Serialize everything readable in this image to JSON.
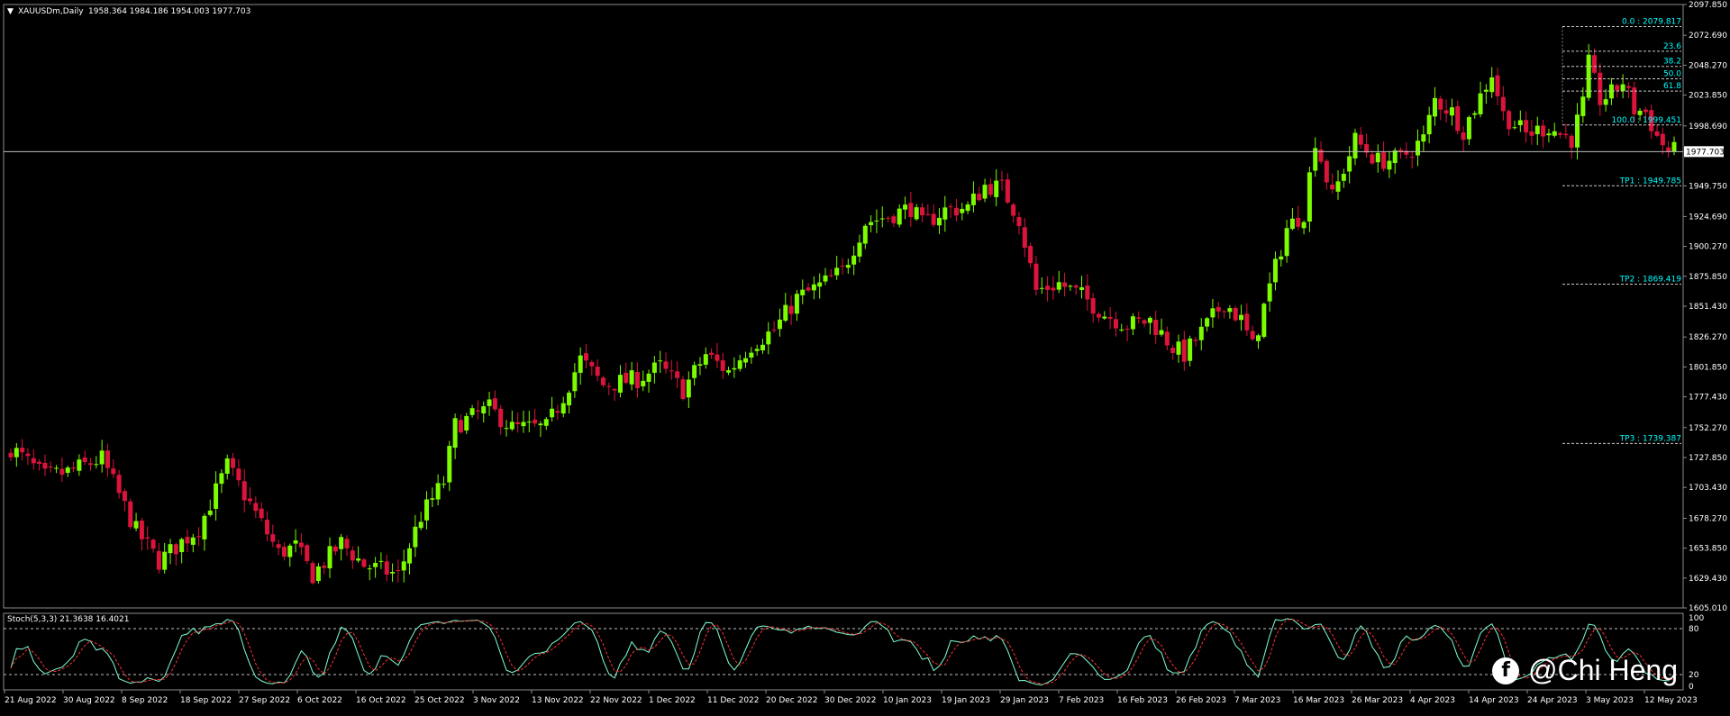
{
  "header": {
    "symbol": "XAUUSDm,Daily",
    "ohlc": "1958.364 1984.186 1954.003 1977.703"
  },
  "indicator": {
    "label": "Stoch(5,3,3) 21.3638 16.4021",
    "levels": [
      "100",
      "80",
      "20",
      "0"
    ]
  },
  "price_axis": {
    "ticks": [
      "2097.850",
      "2072.690",
      "2048.270",
      "2023.850",
      "1998.690",
      "1977.703",
      "1949.750",
      "1924.690",
      "1900.270",
      "1875.850",
      "1851.430",
      "1826.270",
      "1801.850",
      "1777.430",
      "1752.270",
      "1727.850",
      "1703.430",
      "1678.270",
      "1653.850",
      "1629.430",
      "1605.010"
    ],
    "current_price": "1977.703"
  },
  "fib_levels": [
    {
      "label": "0.0 : 2079.817",
      "value": 2079.817
    },
    {
      "label": "23.6",
      "value": 2059.7
    },
    {
      "label": "38.2",
      "value": 2047.3
    },
    {
      "label": "50.0",
      "value": 2037.2
    },
    {
      "label": "61.8",
      "value": 2027.1
    },
    {
      "label": "100.0 : 1999.451",
      "value": 1999.451
    }
  ],
  "targets": [
    {
      "label": "TP1 : 1949.785",
      "value": 1949.785
    },
    {
      "label": "TP2 : 1869.419",
      "value": 1869.419
    },
    {
      "label": "TP3 : 1739.387",
      "value": 1739.387
    }
  ],
  "watermark": "@Chi Heng",
  "chart_data": {
    "type": "candlestick",
    "symbol": "XAUUSDm",
    "timeframe": "Daily",
    "ylim": [
      1605.01,
      2097.85
    ],
    "x_tick_labels": [
      "21 Aug 2022",
      "30 Aug 2022",
      "8 Sep 2022",
      "18 Sep 2022",
      "27 Sep 2022",
      "6 Oct 2022",
      "16 Oct 2022",
      "25 Oct 2022",
      "3 Nov 2022",
      "13 Nov 2022",
      "22 Nov 2022",
      "1 Dec 2022",
      "11 Dec 2022",
      "20 Dec 2022",
      "30 Dec 2022",
      "10 Jan 2023",
      "19 Jan 2023",
      "29 Jan 2023",
      "7 Feb 2023",
      "16 Feb 2023",
      "26 Feb 2023",
      "7 Mar 2023",
      "16 Mar 2023",
      "26 Mar 2023",
      "4 Apr 2023",
      "14 Apr 2023",
      "24 Apr 2023",
      "3 May 2023",
      "12 May 2023"
    ],
    "close_path": [
      {
        "i": 0,
        "c": 1736
      },
      {
        "i": 6,
        "c": 1712
      },
      {
        "i": 10,
        "c": 1716
      },
      {
        "i": 16,
        "c": 1727
      },
      {
        "i": 22,
        "c": 1668
      },
      {
        "i": 26,
        "c": 1643
      },
      {
        "i": 30,
        "c": 1659
      },
      {
        "i": 33,
        "c": 1670
      },
      {
        "i": 38,
        "c": 1721
      },
      {
        "i": 42,
        "c": 1690
      },
      {
        "i": 47,
        "c": 1650
      },
      {
        "i": 50,
        "c": 1655
      },
      {
        "i": 53,
        "c": 1632
      },
      {
        "i": 58,
        "c": 1658
      },
      {
        "i": 62,
        "c": 1640
      },
      {
        "i": 68,
        "c": 1632
      },
      {
        "i": 72,
        "c": 1680
      },
      {
        "i": 76,
        "c": 1708
      },
      {
        "i": 78,
        "c": 1754
      },
      {
        "i": 84,
        "c": 1768
      },
      {
        "i": 88,
        "c": 1752
      },
      {
        "i": 94,
        "c": 1752
      },
      {
        "i": 97,
        "c": 1778
      },
      {
        "i": 100,
        "c": 1808
      },
      {
        "i": 104,
        "c": 1787
      },
      {
        "i": 110,
        "c": 1792
      },
      {
        "i": 114,
        "c": 1802
      },
      {
        "i": 118,
        "c": 1783
      },
      {
        "i": 122,
        "c": 1812
      },
      {
        "i": 126,
        "c": 1798
      },
      {
        "i": 130,
        "c": 1820
      },
      {
        "i": 134,
        "c": 1832
      },
      {
        "i": 138,
        "c": 1858
      },
      {
        "i": 142,
        "c": 1868
      },
      {
        "i": 146,
        "c": 1880
      },
      {
        "i": 150,
        "c": 1920
      },
      {
        "i": 154,
        "c": 1925
      },
      {
        "i": 158,
        "c": 1932
      },
      {
        "i": 160,
        "c": 1918
      },
      {
        "i": 164,
        "c": 1930
      },
      {
        "i": 168,
        "c": 1932
      },
      {
        "i": 171,
        "c": 1950
      },
      {
        "i": 174,
        "c": 1948
      },
      {
        "i": 177,
        "c": 1923
      },
      {
        "i": 180,
        "c": 1864
      },
      {
        "i": 184,
        "c": 1870
      },
      {
        "i": 188,
        "c": 1860
      },
      {
        "i": 192,
        "c": 1845
      },
      {
        "i": 196,
        "c": 1836
      },
      {
        "i": 200,
        "c": 1840
      },
      {
        "i": 204,
        "c": 1818
      },
      {
        "i": 206,
        "c": 1812
      },
      {
        "i": 210,
        "c": 1836
      },
      {
        "i": 213,
        "c": 1855
      },
      {
        "i": 216,
        "c": 1840
      },
      {
        "i": 218,
        "c": 1818
      },
      {
        "i": 221,
        "c": 1867
      },
      {
        "i": 224,
        "c": 1915
      },
      {
        "i": 227,
        "c": 1928
      },
      {
        "i": 229,
        "c": 1988
      },
      {
        "i": 232,
        "c": 1940
      },
      {
        "i": 236,
        "c": 1987
      },
      {
        "i": 240,
        "c": 1970
      },
      {
        "i": 244,
        "c": 1972
      },
      {
        "i": 248,
        "c": 1988
      },
      {
        "i": 250,
        "c": 2020
      },
      {
        "i": 253,
        "c": 2010
      },
      {
        "i": 255,
        "c": 1995
      },
      {
        "i": 258,
        "c": 2023
      },
      {
        "i": 260,
        "c": 2042
      },
      {
        "i": 262,
        "c": 2008
      },
      {
        "i": 266,
        "c": 1992
      },
      {
        "i": 270,
        "c": 1998
      },
      {
        "i": 272,
        "c": 1992
      },
      {
        "i": 274,
        "c": 1988
      },
      {
        "i": 276,
        "c": 2017
      },
      {
        "i": 277,
        "c": 2049
      },
      {
        "i": 279,
        "c": 2020
      },
      {
        "i": 281,
        "c": 2025
      },
      {
        "i": 283,
        "c": 2035
      },
      {
        "i": 285,
        "c": 2012
      },
      {
        "i": 287,
        "c": 2010
      },
      {
        "i": 289,
        "c": 1990
      },
      {
        "i": 291,
        "c": 1978
      }
    ],
    "stochastic": {
      "name": "Stoch(5,3,3)",
      "main": 21.3638,
      "signal": 16.4021,
      "levels": [
        0,
        20,
        80,
        100
      ]
    }
  }
}
